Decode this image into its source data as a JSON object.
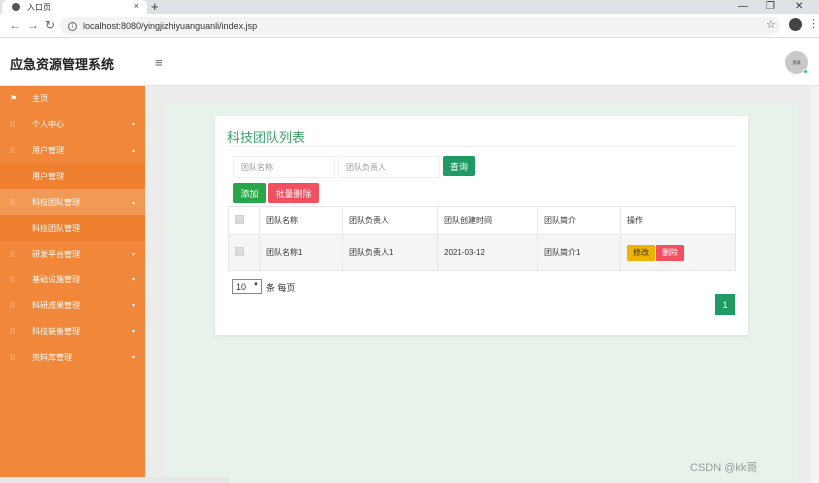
{
  "browser": {
    "tab_title": "入口页",
    "tab_close": "×",
    "new_tab": "+",
    "url": "localhost:8080/yingjizhiyuanguanli/index.jsp",
    "win_min": "—",
    "win_max": "❐",
    "win_close": "✕"
  },
  "header": {
    "title": "应急资源管理系统",
    "avatar_text": "资源"
  },
  "sidebar": {
    "items": [
      {
        "label": "主页"
      },
      {
        "label": "个人中心"
      },
      {
        "label": "用户管理"
      },
      {
        "label": "用户管理"
      },
      {
        "label": "科技团队管理"
      },
      {
        "label": "科技团队管理"
      },
      {
        "label": "研发平台管理"
      },
      {
        "label": "基础设施管理"
      },
      {
        "label": "科研成果管理"
      },
      {
        "label": "科技装备管理"
      },
      {
        "label": "资料库管理"
      }
    ]
  },
  "card": {
    "title": "科技团队列表",
    "search_name_placeholder": "团队名称",
    "search_leader_placeholder": "团队负责人",
    "query_label": "查询",
    "add_label": "添加",
    "batch_delete_label": "批量删除"
  },
  "table": {
    "columns": [
      "团队名称",
      "团队负责人",
      "团队创建时间",
      "团队简介",
      "操作"
    ],
    "rows": [
      {
        "name": "团队名称1",
        "leader": "团队负责人1",
        "created": "2021-03-12",
        "intro": "团队简介1",
        "edit": "修改",
        "delete": "删除"
      }
    ]
  },
  "pager": {
    "page_size": "10",
    "per_page_text": "条 每页",
    "current_page": "1"
  },
  "watermark": "CSDN @kk哥",
  "colors": {
    "sidebar": "#f0873a",
    "primary_green": "#1f9a64",
    "danger": "#f05060",
    "warning": "#f0b400",
    "title_green": "#3aa36b"
  }
}
